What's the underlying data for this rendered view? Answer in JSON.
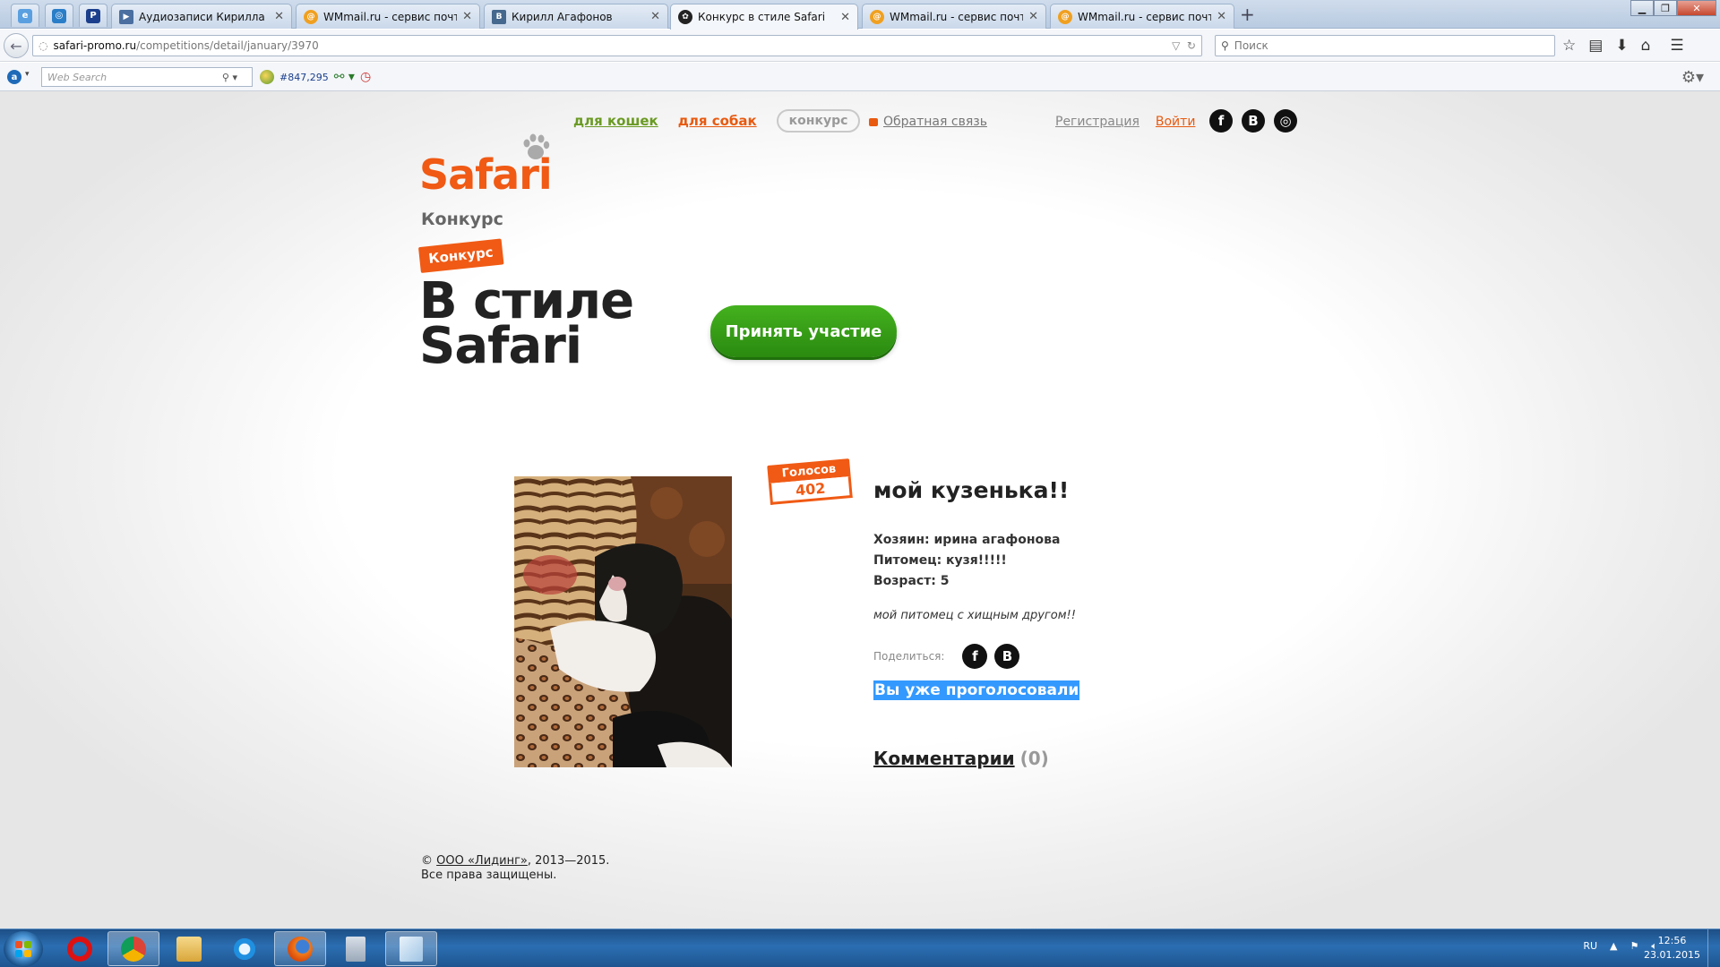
{
  "browser": {
    "tabs": [
      {
        "title": "Аудиозаписи Кирилла Ко...",
        "icon": "video-icon",
        "active": false
      },
      {
        "title": "WMmail.ru - сервис почт...",
        "icon": "wmmail-icon",
        "active": false
      },
      {
        "title": "Кирилл Агафонов",
        "icon": "vk-icon",
        "active": false
      },
      {
        "title": "Конкурс в стиле Safari",
        "icon": "paw-icon",
        "active": true
      },
      {
        "title": "WMmail.ru - сервис почт...",
        "icon": "wmmail-icon",
        "active": false
      },
      {
        "title": "WMmail.ru - сервис почт...",
        "icon": "wmmail-icon",
        "active": false
      }
    ],
    "new_tab": "+",
    "url_host": "safari-promo.ru",
    "url_path": "/competitions/detail/january/3970",
    "search_placeholder": "Поиск",
    "web_search_placeholder": "Web Search",
    "alexa_rank": "#847,295"
  },
  "site": {
    "logo_brand": "Safari",
    "logo_sub": "Конкурс",
    "nav": {
      "cats": "для кошек",
      "dogs": "для собак",
      "contest": "конкурс",
      "feedback": "Обратная связь",
      "register": "Регистрация",
      "login": "Войти"
    },
    "social": [
      "f",
      "B",
      "◎"
    ],
    "badge": "Конкурс",
    "headline_line1": "В стиле",
    "headline_line2": "Safari",
    "join_button": "Принять участие",
    "votes_label": "Голосов",
    "votes_count": "402",
    "pet_title": "мой кузенька!!",
    "owner": "Хозяин: ирина агафонова",
    "pet": "Питомец: кузя!!!!!",
    "age": "Возраст: 5",
    "description": "мой питомец с хищным другом!!",
    "share_label": "Поделиться:",
    "share_icons": [
      "f",
      "B"
    ],
    "voted_text": "Вы уже проголосовали",
    "comments_label": "Комментарии",
    "comments_count": "(0)",
    "footer_copy": "©",
    "footer_company": "ООО «Лидинг»",
    "footer_years": ", 2013—2015.",
    "footer_rights": "Все права защищены."
  },
  "taskbar": {
    "lang": "RU",
    "time": "12:56",
    "date": "23.01.2015"
  },
  "colors": {
    "brand_orange": "#f05a14",
    "cats_green": "#6a9a23",
    "join_green": "#2f9a14",
    "selection_blue": "#3399ff"
  }
}
